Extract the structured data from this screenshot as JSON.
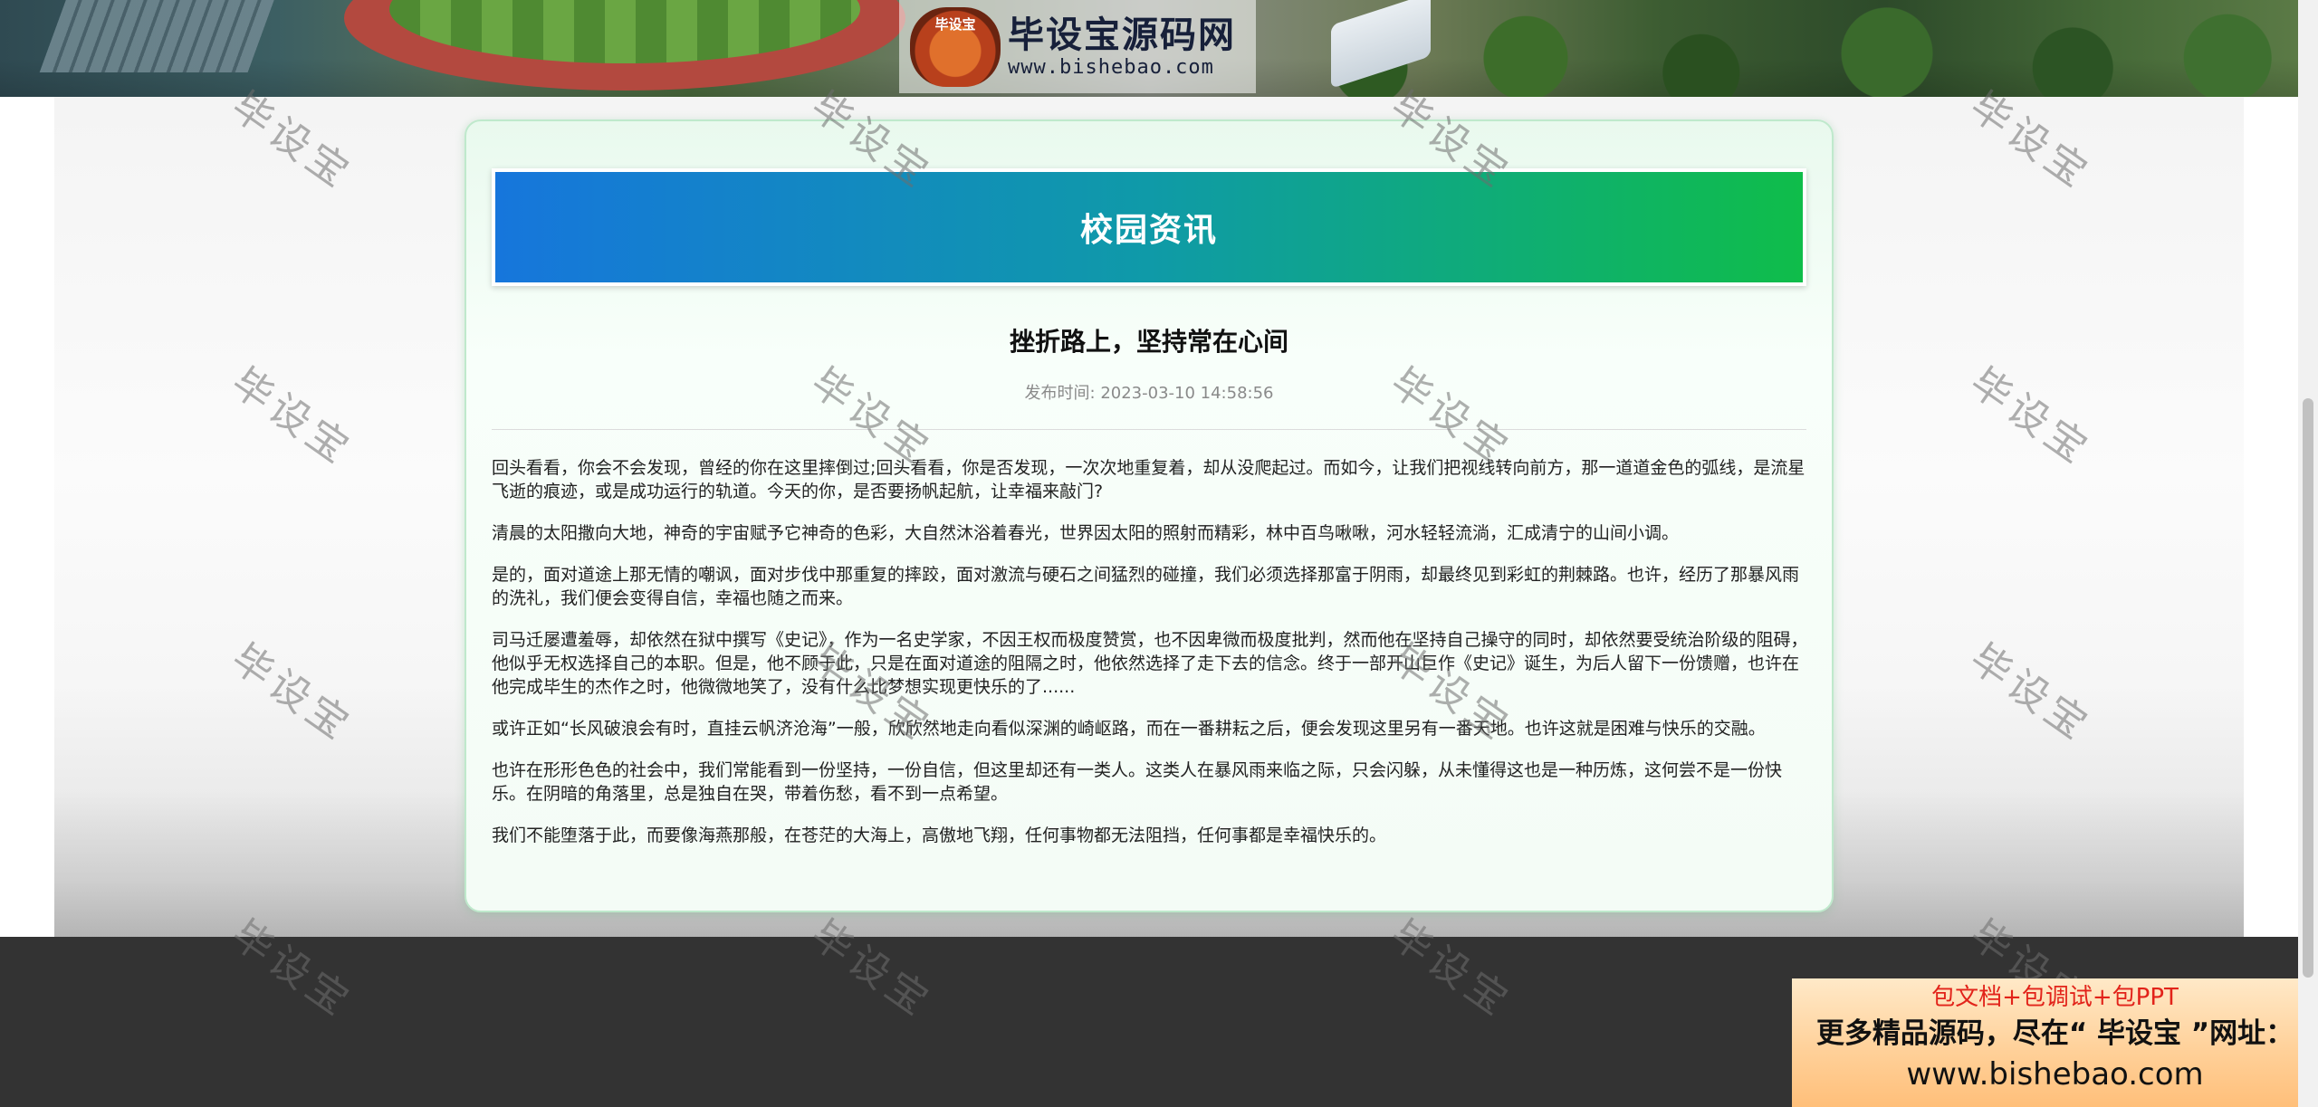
{
  "banner": {
    "logo_badge": "毕设宝",
    "logo_title": "毕设宝源码网",
    "logo_url": "www.bishebao.com"
  },
  "section": {
    "title": "校园资讯"
  },
  "article": {
    "title": "挫折路上，坚持常在心间",
    "publish_label": "发布时间:",
    "publish_time": "2023-03-10 14:58:56",
    "paragraphs": [
      "回头看看，你会不会发现，曾经的你在这里摔倒过;回头看看，你是否发现，一次次地重复着，却从没爬起过。而如今，让我们把视线转向前方，那一道道金色的弧线，是流星飞逝的痕迹，或是成功运行的轨道。今天的你，是否要扬帆起航，让幸福来敲门?",
      "清晨的太阳撒向大地，神奇的宇宙赋予它神奇的色彩，大自然沐浴着春光，世界因太阳的照射而精彩，林中百鸟啾啾，河水轻轻流淌，汇成清宁的山间小调。",
      "是的，面对道途上那无情的嘲讽，面对步伐中那重复的摔跤，面对激流与硬石之间猛烈的碰撞，我们必须选择那富于阴雨，却最终见到彩虹的荆棘路。也许，经历了那暴风雨的洗礼，我们便会变得自信，幸福也随之而来。",
      "司马迁屡遭羞辱，却依然在狱中撰写《史记》，作为一名史学家，不因王权而极度赞赏，也不因卑微而极度批判，然而他在坚持自己操守的同时，却依然要受统治阶级的阻碍，他似乎无权选择自己的本职。但是，他不顾于此，只是在面对道途的阻隔之时，他依然选择了走下去的信念。终于一部开山巨作《史记》诞生，为后人留下一份馈赠，也许在他完成毕生的杰作之时，他微微地笑了，没有什么比梦想实现更快乐的了......",
      "或许正如“长风破浪会有时，直挂云帆济沧海”一般，欣欣然地走向看似深渊的崎岖路，而在一番耕耘之后，便会发现这里另有一番天地。也许这就是困难与快乐的交融。",
      "也许在形形色色的社会中，我们常能看到一份坚持，一份自信，但这里却还有一类人。这类人在暴风雨来临之际，只会闪躲，从未懂得这也是一种历炼，这何尝不是一份快乐。在阴暗的角落里，总是独自在哭，带着伤愁，看不到一点希望。",
      "我们不能堕落于此，而要像海燕那般，在苍茫的大海上，高傲地飞翔，任何事物都无法阻挡，任何事都是幸福快乐的。"
    ]
  },
  "watermark_text": "毕设宝",
  "promo": {
    "line1": "包文档+包调试+包PPT",
    "line2": "更多精品源码，尽在“ 毕设宝 ”网址：",
    "line3": "www.bishebao.com"
  }
}
